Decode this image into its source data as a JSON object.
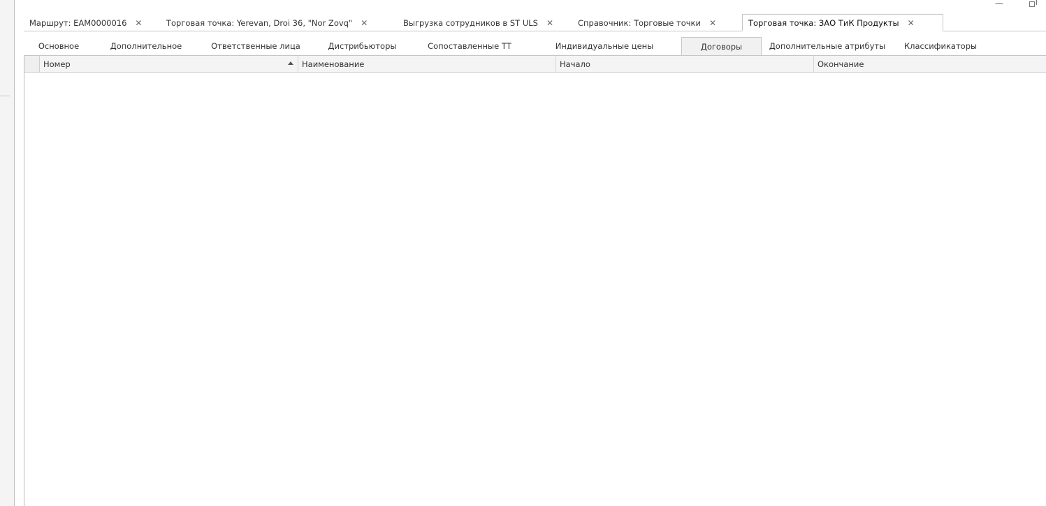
{
  "window": {
    "minimize_glyph": "—",
    "restore_icon": "restore-icon"
  },
  "doc_tabs": [
    {
      "label": "Маршрут: EAM0000016",
      "close": "✕",
      "active": false
    },
    {
      "label": "Торговая точка: Yerevan, Droi 36, \"Nor Zovq\"",
      "close": "✕",
      "active": false
    },
    {
      "label": "Выгрузка сотрудников в ST ULS",
      "close": "✕",
      "active": false
    },
    {
      "label": "Справочник: Торговые точки",
      "close": "✕",
      "active": false
    },
    {
      "label": "Торговая точка: ЗАО ТиК Продукты",
      "close": "✕",
      "active": true
    }
  ],
  "inner_tabs": [
    {
      "label": "Основное",
      "active": false
    },
    {
      "label": "Дополнительное",
      "active": false
    },
    {
      "label": "Ответственные лица",
      "active": false
    },
    {
      "label": "Дистрибьюторы",
      "active": false
    },
    {
      "label": "Сопоставленные ТТ",
      "active": false
    },
    {
      "label": "Индивидуальные цены",
      "active": false
    },
    {
      "label": "Договоры",
      "active": true
    },
    {
      "label": "Дополнительные атрибуты",
      "active": false
    },
    {
      "label": "Классификаторы",
      "active": false
    }
  ],
  "grid": {
    "columns": [
      {
        "label": "Номер",
        "sort": "ascending"
      },
      {
        "label": "Наименование"
      },
      {
        "label": "Начало"
      },
      {
        "label": "Окончание"
      }
    ],
    "rows": []
  },
  "colors": {
    "tab_border": "#c6c6c6",
    "header_bg": "#f4f4f4",
    "active_inner_tab_bg": "#f1f1f1"
  }
}
